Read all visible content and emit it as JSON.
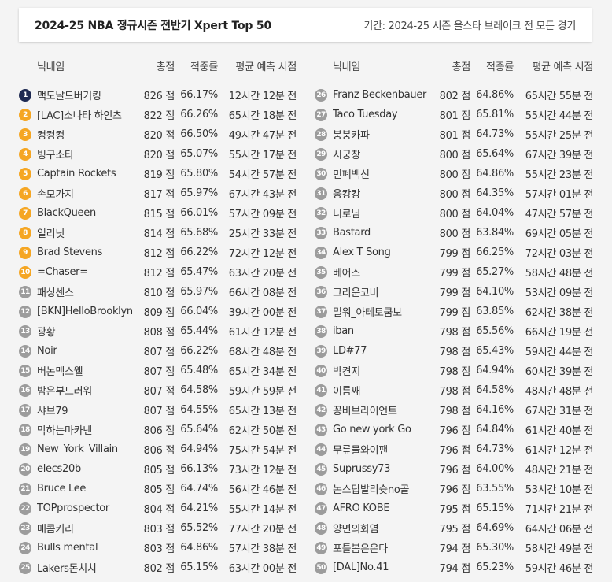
{
  "header": {
    "title": "2024-25 NBA 정규시즌 전반기 Xpert Top 50",
    "period": "기간: 2024-25 시즌 올스타 브레이크 전 모든 경기"
  },
  "columns": {
    "nickname": "닉네임",
    "score": "총점",
    "rate": "적중률",
    "time": "평균 예측 시점"
  },
  "colors": {
    "top1": "#1e2a52",
    "top10": "#f5a623",
    "rest": "#9c9c9c"
  },
  "left_rows": [
    {
      "rank": "1",
      "name": "맥도날드버거킹",
      "score": "826 점",
      "rate": "66.17%",
      "time": "12시간 12분 전"
    },
    {
      "rank": "2",
      "name": "[LAC]소나타 하인츠",
      "score": "822 점",
      "rate": "66.26%",
      "time": "65시간 18분 전"
    },
    {
      "rank": "3",
      "name": "컹컹컹",
      "score": "820 점",
      "rate": "66.50%",
      "time": "49시간 47분 전"
    },
    {
      "rank": "4",
      "name": "빙구소타",
      "score": "820 점",
      "rate": "65.07%",
      "time": "55시간 17분 전"
    },
    {
      "rank": "5",
      "name": "Captain Rockets",
      "score": "819 점",
      "rate": "65.80%",
      "time": "54시간 57분 전"
    },
    {
      "rank": "6",
      "name": "손모가지",
      "score": "817 점",
      "rate": "65.97%",
      "time": "67시간 43분 전"
    },
    {
      "rank": "7",
      "name": "BlackQueen",
      "score": "815 점",
      "rate": "66.01%",
      "time": "57시간 09분 전"
    },
    {
      "rank": "8",
      "name": "일리닛",
      "score": "814 점",
      "rate": "65.68%",
      "time": "25시간 33분 전"
    },
    {
      "rank": "9",
      "name": "Brad Stevens",
      "score": "812 점",
      "rate": "66.22%",
      "time": "72시간 12분 전"
    },
    {
      "rank": "10",
      "name": "=Chaser=",
      "score": "812 점",
      "rate": "65.47%",
      "time": "63시간 20분 전"
    },
    {
      "rank": "11",
      "name": "패싱센스",
      "score": "810 점",
      "rate": "65.97%",
      "time": "66시간 08분 전"
    },
    {
      "rank": "12",
      "name": "[BKN]HelloBrooklyn",
      "score": "809 점",
      "rate": "66.04%",
      "time": "39시간 00분 전"
    },
    {
      "rank": "13",
      "name": "광황",
      "score": "808 점",
      "rate": "65.44%",
      "time": "61시간 12분 전"
    },
    {
      "rank": "14",
      "name": "Noir",
      "score": "807 점",
      "rate": "66.22%",
      "time": "68시간 48분 전"
    },
    {
      "rank": "15",
      "name": "버논맥스웰",
      "score": "807 점",
      "rate": "65.48%",
      "time": "65시간 34분 전"
    },
    {
      "rank": "16",
      "name": "밤은부드러워",
      "score": "807 점",
      "rate": "64.58%",
      "time": "59시간 59분 전"
    },
    {
      "rank": "17",
      "name": "샤브79",
      "score": "807 점",
      "rate": "64.55%",
      "time": "65시간 13분 전"
    },
    {
      "rank": "18",
      "name": "막하는마카넨",
      "score": "806 점",
      "rate": "65.64%",
      "time": "62시간 50분 전"
    },
    {
      "rank": "19",
      "name": "New_York_Villain",
      "score": "806 점",
      "rate": "64.94%",
      "time": "75시간 54분 전"
    },
    {
      "rank": "20",
      "name": "elecs20b",
      "score": "805 점",
      "rate": "66.13%",
      "time": "73시간 12분 전"
    },
    {
      "rank": "21",
      "name": "Bruce Lee",
      "score": "805 점",
      "rate": "64.74%",
      "time": "56시간 46분 전"
    },
    {
      "rank": "22",
      "name": "TOPprospector",
      "score": "804 점",
      "rate": "64.21%",
      "time": "55시간 14분 전"
    },
    {
      "rank": "23",
      "name": "매콤커리",
      "score": "803 점",
      "rate": "65.52%",
      "time": "77시간 20분 전"
    },
    {
      "rank": "24",
      "name": "Bulls mental",
      "score": "803 점",
      "rate": "64.86%",
      "time": "57시간 38분 전"
    },
    {
      "rank": "25",
      "name": "Lakers돈치치",
      "score": "802 점",
      "rate": "65.15%",
      "time": "63시간 00분 전"
    }
  ],
  "right_rows": [
    {
      "rank": "26",
      "name": "Franz Beckenbauer",
      "score": "802 점",
      "rate": "64.86%",
      "time": "65시간 55분 전"
    },
    {
      "rank": "27",
      "name": "Taco Tuesday",
      "score": "801 점",
      "rate": "65.81%",
      "time": "55시간 44분 전"
    },
    {
      "rank": "28",
      "name": "붕붕카파",
      "score": "801 점",
      "rate": "64.73%",
      "time": "55시간 25분 전"
    },
    {
      "rank": "29",
      "name": "시궁창",
      "score": "800 점",
      "rate": "65.64%",
      "time": "67시간 39분 전"
    },
    {
      "rank": "30",
      "name": "민폐백신",
      "score": "800 점",
      "rate": "64.86%",
      "time": "55시간 23분 전"
    },
    {
      "rank": "31",
      "name": "웅캉캉",
      "score": "800 점",
      "rate": "64.35%",
      "time": "57시간 01분 전"
    },
    {
      "rank": "32",
      "name": "니로님",
      "score": "800 점",
      "rate": "64.04%",
      "time": "47시간 57분 전"
    },
    {
      "rank": "33",
      "name": "Bastard",
      "score": "800 점",
      "rate": "63.84%",
      "time": "69시간 05분 전"
    },
    {
      "rank": "34",
      "name": "Alex T Song",
      "score": "799 점",
      "rate": "66.25%",
      "time": "72시간 03분 전"
    },
    {
      "rank": "35",
      "name": "베어스",
      "score": "799 점",
      "rate": "65.27%",
      "time": "58시간 48분 전"
    },
    {
      "rank": "36",
      "name": "그리운코비",
      "score": "799 점",
      "rate": "64.10%",
      "time": "53시간 09분 전"
    },
    {
      "rank": "37",
      "name": "밀워_아테토쿰보",
      "score": "799 점",
      "rate": "63.85%",
      "time": "62시간 38분 전"
    },
    {
      "rank": "38",
      "name": "iban",
      "score": "798 점",
      "rate": "65.56%",
      "time": "66시간 19분 전"
    },
    {
      "rank": "39",
      "name": "LD#77",
      "score": "798 점",
      "rate": "65.43%",
      "time": "59시간 44분 전"
    },
    {
      "rank": "40",
      "name": "박켠지",
      "score": "798 점",
      "rate": "64.94%",
      "time": "60시간 39분 전"
    },
    {
      "rank": "41",
      "name": "이름쌔",
      "score": "798 점",
      "rate": "64.58%",
      "time": "48시간 48분 전"
    },
    {
      "rank": "42",
      "name": "꽁비브라이언트",
      "score": "798 점",
      "rate": "64.16%",
      "time": "67시간 31분 전"
    },
    {
      "rank": "43",
      "name": "Go new york Go",
      "score": "796 점",
      "rate": "64.84%",
      "time": "61시간 40분 전"
    },
    {
      "rank": "44",
      "name": "무릎물와이팬",
      "score": "796 점",
      "rate": "64.73%",
      "time": "61시간 12분 전"
    },
    {
      "rank": "45",
      "name": "Suprussy73",
      "score": "796 점",
      "rate": "64.00%",
      "time": "48시간 21분 전"
    },
    {
      "rank": "46",
      "name": "논스탑발리슛no골",
      "score": "796 점",
      "rate": "63.55%",
      "time": "53시간 10분 전"
    },
    {
      "rank": "47",
      "name": "AFRO KOBE",
      "score": "795 점",
      "rate": "65.15%",
      "time": "71시간 21분 전"
    },
    {
      "rank": "48",
      "name": "양면의화염",
      "score": "795 점",
      "rate": "64.69%",
      "time": "64시간 06분 전"
    },
    {
      "rank": "49",
      "name": "포틀봄은온다",
      "score": "794 점",
      "rate": "65.30%",
      "time": "58시간 49분 전"
    },
    {
      "rank": "50",
      "name": "[DAL]No.41",
      "score": "794 점",
      "rate": "65.23%",
      "time": "59시간 46분 전"
    }
  ]
}
